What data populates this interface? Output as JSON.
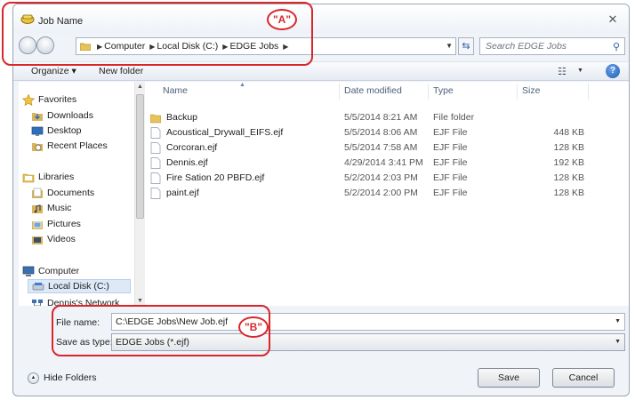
{
  "window": {
    "title": "Job Name",
    "close_glyph": "✕"
  },
  "address": {
    "crumbs": [
      "Computer",
      "Local Disk (C:)",
      "EDGE Jobs"
    ],
    "search_placeholder": "Search EDGE Jobs"
  },
  "toolbar": {
    "organize_label": "Organize ▾",
    "new_folder_label": "New folder"
  },
  "nav": {
    "items": [
      {
        "label": "Favorites",
        "icon": "star-icon"
      },
      {
        "label": "Downloads",
        "icon": "downloads-icon"
      },
      {
        "label": "Desktop",
        "icon": "desktop-icon"
      },
      {
        "label": "Recent Places",
        "icon": "recent-places-icon"
      },
      {
        "label": "Libraries",
        "icon": "libraries-icon"
      },
      {
        "label": "Documents",
        "icon": "documents-icon"
      },
      {
        "label": "Music",
        "icon": "music-icon"
      },
      {
        "label": "Pictures",
        "icon": "pictures-icon"
      },
      {
        "label": "Videos",
        "icon": "videos-icon"
      },
      {
        "label": "Computer",
        "icon": "computer-icon"
      },
      {
        "label": "Local Disk (C:)",
        "icon": "drive-icon",
        "selected": true
      },
      {
        "label": "Dennis's Network",
        "icon": "network-icon"
      }
    ]
  },
  "columns": {
    "name": "Name",
    "date": "Date modified",
    "type": "Type",
    "size": "Size"
  },
  "files": [
    {
      "name": "Backup",
      "date": "5/5/2014 8:21 AM",
      "type": "File folder",
      "size": "",
      "icon": "folder-icon"
    },
    {
      "name": "Acoustical_Drywall_EIFS.ejf",
      "date": "5/5/2014 8:06 AM",
      "type": "EJF File",
      "size": "448 KB",
      "icon": "file-icon"
    },
    {
      "name": "Corcoran.ejf",
      "date": "5/5/2014 7:58 AM",
      "type": "EJF File",
      "size": "128 KB",
      "icon": "file-icon"
    },
    {
      "name": "Dennis.ejf",
      "date": "4/29/2014 3:41 PM",
      "type": "EJF File",
      "size": "192 KB",
      "icon": "file-icon"
    },
    {
      "name": "Fire Sation 20 PBFD.ejf",
      "date": "5/2/2014 2:03 PM",
      "type": "EJF File",
      "size": "128 KB",
      "icon": "file-icon"
    },
    {
      "name": "paint.ejf",
      "date": "5/2/2014 2:00 PM",
      "type": "EJF File",
      "size": "128 KB",
      "icon": "file-icon"
    }
  ],
  "save": {
    "file_name_label": "File name:",
    "file_name_value": "C:\\EDGE Jobs\\New Job.ejf",
    "save_as_type_label": "Save as type:",
    "save_as_type_value": "EDGE Jobs (*.ejf)"
  },
  "footer": {
    "hide_folders_label": "Hide Folders",
    "save_label": "Save",
    "cancel_label": "Cancel"
  },
  "annotations": {
    "a_label": "\"A\"",
    "b_label": "\"B\"",
    "color": "#d9262a"
  },
  "colors": {
    "selection": "#dde9f7",
    "folder": "#e8c35c",
    "accent": "#2b5fa7"
  }
}
